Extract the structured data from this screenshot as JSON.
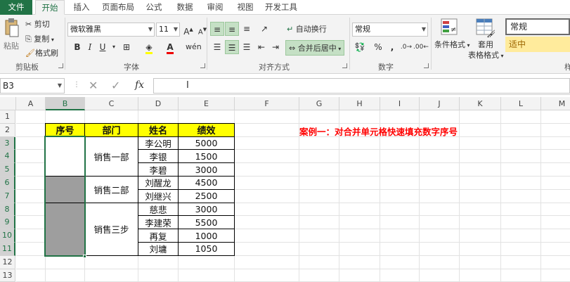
{
  "tabs": [
    "文件",
    "开始",
    "插入",
    "页面布局",
    "公式",
    "数据",
    "审阅",
    "视图",
    "开发工具"
  ],
  "clipboard": {
    "paste": "粘贴",
    "cut": "剪切",
    "copy": "复制",
    "format_painter": "格式刷",
    "label": "剪贴板"
  },
  "font": {
    "name": "微软雅黑",
    "size": "11",
    "label": "字体"
  },
  "alignment": {
    "wrap": "自动换行",
    "merge": "合并后居中",
    "label": "对齐方式"
  },
  "number": {
    "format": "常规",
    "label": "数字"
  },
  "styles": {
    "conditional": "条件格式",
    "table_format_1": "套用",
    "table_format_2": "表格格式",
    "normal": "常规",
    "neutral": "适中",
    "truncated": "样"
  },
  "formula_bar": {
    "name_box": "B3",
    "fx": "fx",
    "value": ""
  },
  "columns": [
    "A",
    "B",
    "C",
    "D",
    "E",
    "F",
    "G",
    "H",
    "I",
    "J",
    "K",
    "L",
    "M"
  ],
  "rows": [
    "1",
    "2",
    "3",
    "4",
    "5",
    "6",
    "7",
    "8",
    "9",
    "10",
    "11",
    "12",
    "13"
  ],
  "table": {
    "headers": [
      "序号",
      "部门",
      "姓名",
      "绩效"
    ],
    "departments": [
      "销售一部",
      "销售二部",
      "销售三步"
    ],
    "rows": [
      [
        "李公明",
        "5000"
      ],
      [
        "李银",
        "1500"
      ],
      [
        "李碧",
        "3000"
      ],
      [
        "刘醒龙",
        "4500"
      ],
      [
        "刘继兴",
        "2500"
      ],
      [
        "慈悲",
        "3000"
      ],
      [
        "李建荣",
        "5500"
      ],
      [
        "再复",
        "1000"
      ],
      [
        "刘墉",
        "1050"
      ]
    ]
  },
  "annotation": "案例一：对合并单元格快速填充数字序号",
  "colors": {
    "accent": "#217346",
    "header_fill": "#ffff00",
    "annotation": "#ff0000",
    "selection": "#9e9e9e"
  }
}
